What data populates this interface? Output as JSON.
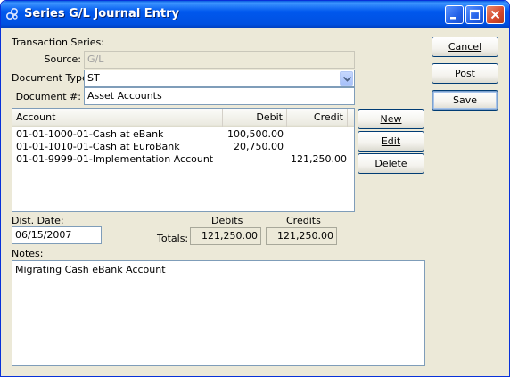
{
  "window": {
    "title": "Series G/L Journal Entry"
  },
  "form": {
    "transaction_series_label": "Transaction Series:",
    "source_label": "Source:",
    "source_value": "G/L",
    "document_type_label": "Document Type:",
    "document_type_value": "ST",
    "document_number_label": "Document #:",
    "document_number_value": "Asset Accounts"
  },
  "table": {
    "columns": [
      "Account",
      "Debit",
      "Credit"
    ],
    "rows": [
      {
        "account": "01-01-1000-01-Cash at eBank",
        "debit": "100,500.00",
        "credit": ""
      },
      {
        "account": "01-01-1010-01-Cash at EuroBank",
        "debit": "20,750.00",
        "credit": ""
      },
      {
        "account": "01-01-9999-01-Implementation Account",
        "debit": "",
        "credit": "121,250.00"
      }
    ]
  },
  "row_buttons": {
    "new": "New",
    "edit": "Edit",
    "delete": "Delete"
  },
  "actions": {
    "cancel": "Cancel",
    "post": "Post",
    "save": "Save"
  },
  "dist": {
    "label": "Dist. Date:",
    "value": "06/15/2007"
  },
  "totals": {
    "label": "Totals:",
    "debits_label": "Debits",
    "credits_label": "Credits",
    "debits_value": "121,250.00",
    "credits_value": "121,250.00"
  },
  "notes": {
    "label": "Notes:",
    "value": "Migrating Cash eBank Account"
  },
  "icons": [
    "app-icon",
    "minimize-icon",
    "maximize-icon",
    "close-icon",
    "dropdown-arrow-icon"
  ],
  "colors": {
    "titlebar": "#0054e3",
    "window_bg": "#ece9d8",
    "close_button": "#d5482c"
  }
}
